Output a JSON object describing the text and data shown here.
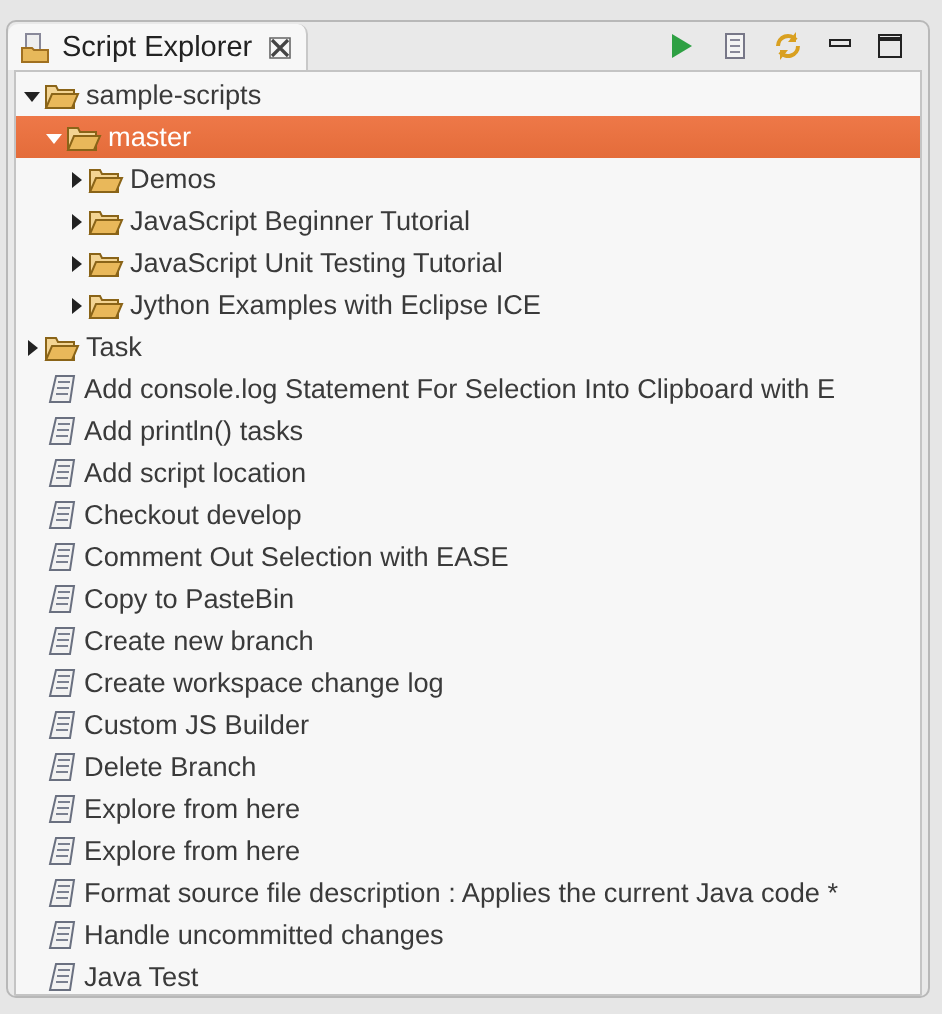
{
  "view": {
    "title": "Script Explorer",
    "toolbar": [
      {
        "kind": "run"
      },
      {
        "kind": "script"
      },
      {
        "kind": "refresh"
      },
      {
        "kind": "minimize"
      },
      {
        "kind": "maximize"
      }
    ]
  },
  "tree": [
    {
      "kind": "folder",
      "label": "sample-scripts",
      "expanded": true,
      "selected": false,
      "children": [
        {
          "kind": "folder",
          "label": "master",
          "expanded": true,
          "selected": true,
          "children": [
            {
              "kind": "folder",
              "label": "Demos",
              "expanded": false,
              "selected": false
            },
            {
              "kind": "folder",
              "label": "JavaScript Beginner Tutorial",
              "expanded": false,
              "selected": false
            },
            {
              "kind": "folder",
              "label": "JavaScript Unit Testing Tutorial",
              "expanded": false,
              "selected": false
            },
            {
              "kind": "folder",
              "label": "Jython Examples with Eclipse ICE",
              "expanded": false,
              "selected": false
            }
          ]
        }
      ]
    },
    {
      "kind": "folder",
      "label": "Task",
      "expanded": false,
      "selected": false
    },
    {
      "kind": "script",
      "label": "Add console.log Statement For Selection Into Clipboard with E",
      "selected": false
    },
    {
      "kind": "script",
      "label": "Add println() tasks",
      "selected": false
    },
    {
      "kind": "script",
      "label": "Add script location",
      "selected": false
    },
    {
      "kind": "script",
      "label": "Checkout develop",
      "selected": false
    },
    {
      "kind": "script",
      "label": "Comment Out Selection with EASE",
      "selected": false
    },
    {
      "kind": "script",
      "label": "Copy to PasteBin",
      "selected": false
    },
    {
      "kind": "script",
      "label": "Create new branch",
      "selected": false
    },
    {
      "kind": "script",
      "label": "Create workspace change log",
      "selected": false
    },
    {
      "kind": "script",
      "label": "Custom JS Builder",
      "selected": false
    },
    {
      "kind": "script",
      "label": "Delete Branch",
      "selected": false
    },
    {
      "kind": "script",
      "label": "Explore from here",
      "selected": false
    },
    {
      "kind": "script",
      "label": "Explore from here",
      "selected": false
    },
    {
      "kind": "script",
      "label": "Format source file description : Applies the current Java code *",
      "selected": false
    },
    {
      "kind": "script",
      "label": "Handle uncommitted changes",
      "selected": false
    },
    {
      "kind": "script",
      "label": "Java Test",
      "selected": false
    }
  ]
}
